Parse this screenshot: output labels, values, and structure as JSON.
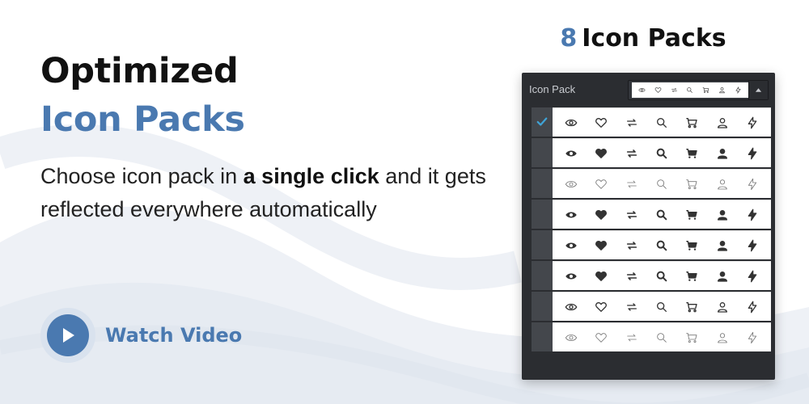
{
  "left": {
    "title_line1": "Optimized",
    "title_line2": "Icon Packs",
    "desc_part1": "Choose icon pack in ",
    "desc_bold": "a single click",
    "desc_part2": " and it gets reflected everywhere automatically"
  },
  "video": {
    "label": "Watch Video",
    "icon": "play-icon"
  },
  "packs": {
    "count": "8",
    "label": "Icon Packs"
  },
  "panel": {
    "label": "Icon Pack",
    "selected_index": 0,
    "icon_names": [
      "eye-icon",
      "heart-icon",
      "repeat-icon",
      "search-icon",
      "cart-icon",
      "user-icon",
      "bolt-icon"
    ],
    "rows": [
      {
        "style": "outline"
      },
      {
        "style": "solid"
      },
      {
        "style": "light"
      },
      {
        "style": "solid"
      },
      {
        "style": "solid"
      },
      {
        "style": "solid"
      },
      {
        "style": "outline"
      },
      {
        "style": "light"
      }
    ]
  },
  "colors": {
    "accent": "#4a79b0",
    "panel_bg": "#2b2d31",
    "check": "#3fa3d6"
  }
}
